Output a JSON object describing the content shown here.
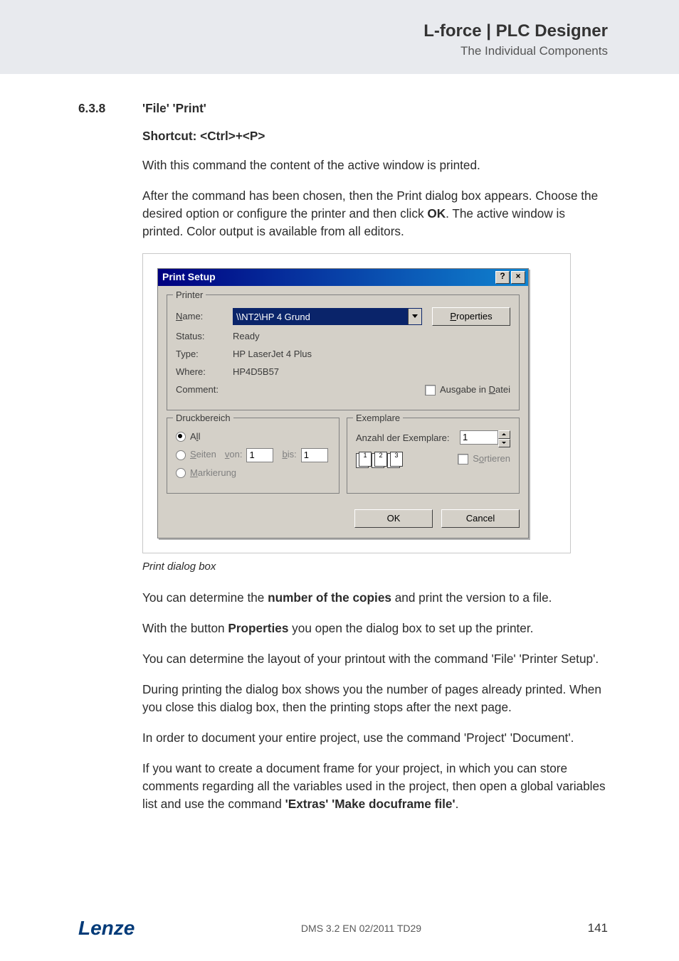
{
  "header": {
    "brand": "L-force | PLC Designer",
    "section": "The Individual Components"
  },
  "section": {
    "number": "6.3.8",
    "title": "'File' 'Print'"
  },
  "shortcut": "Shortcut: <Ctrl>+<P>",
  "paragraphs": {
    "intro1": "With this command the content of the active window is printed.",
    "intro2a": "After the command has been chosen, then the Print dialog box appears. Choose the desired option or configure the printer and then click ",
    "intro2_bold": "OK",
    "intro2b": ". The active window is printed. Color output is available from all editors.",
    "caption": "Print dialog box",
    "p_copies_a": "You can determine the ",
    "p_copies_bold": "number of the copies",
    "p_copies_b": " and print the version to a file.",
    "p_props_a": "With the button ",
    "p_props_bold": "Properties",
    "p_props_b": " you open the dialog box to set up the printer.",
    "p_layout": "You can determine the layout of your printout with the command 'File' 'Printer Setup'.",
    "p_during": "During printing the dialog box shows you the number of pages already printed. When you close this dialog box, then the printing stops after the next page.",
    "p_document": "In order to document your entire project, use the command 'Project' 'Document'.",
    "p_docframe_a": "If you want to create a document frame for your project, in which you can store comments regarding all the variables used in the project, then open a global variables list and use the command ",
    "p_docframe_bold": "'Extras' 'Make docuframe file'",
    "p_docframe_b": "."
  },
  "dialog": {
    "title": "Print Setup",
    "help": "?",
    "close": "×",
    "printer_group": "Printer",
    "name_label": "Name:",
    "name_value": "\\\\NT2\\HP 4 Grund",
    "properties_btn": "Properties",
    "status_label": "Status:",
    "status_value": "Ready",
    "type_label": "Type:",
    "type_value": "HP LaserJet 4 Plus",
    "where_label": "Where:",
    "where_value": "HP4D5B57",
    "comment_label": "Comment:",
    "to_file": "Ausgabe in Datei",
    "range_group": "Druckbereich",
    "range_all": "All",
    "range_pages": "Seiten",
    "range_from_label": "von:",
    "range_from_value": "1",
    "range_to_label": "bis:",
    "range_to_value": "1",
    "range_selection": "Markierung",
    "copies_group": "Exemplare",
    "copies_label": "Anzahl der Exemplare:",
    "copies_value": "1",
    "collate_label": "Sortieren",
    "ok": "OK",
    "cancel": "Cancel"
  },
  "footer": {
    "logo": "Lenze",
    "doc_id": "DMS 3.2 EN 02/2011 TD29",
    "page": "141"
  }
}
